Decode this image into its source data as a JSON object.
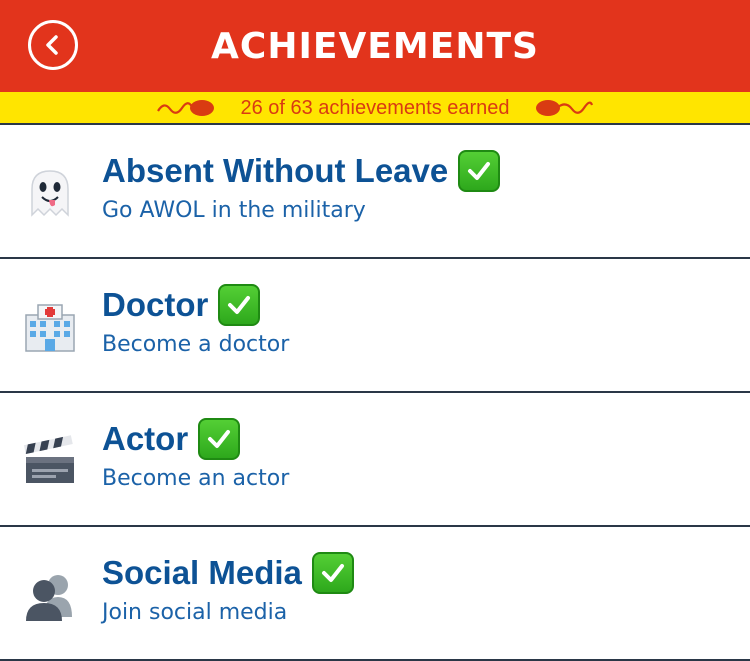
{
  "header": {
    "title": "ACHIEVEMENTS",
    "back_icon": "back-chevron-icon",
    "background_color": "#e2341c"
  },
  "banner": {
    "text": "26 of 63 achievements earned",
    "background_color": "#ffe500",
    "text_color": "#d93b12"
  },
  "achievements": [
    {
      "name": "Absent Without Leave",
      "description": "Go AWOL in the military",
      "icon": "ghost-icon",
      "earned": true
    },
    {
      "name": "Doctor",
      "description": "Become a doctor",
      "icon": "hospital-icon",
      "earned": true
    },
    {
      "name": "Actor",
      "description": "Become an actor",
      "icon": "clapperboard-icon",
      "earned": true
    },
    {
      "name": "Social Media",
      "description": "Join social media",
      "icon": "people-silhouette-icon",
      "earned": true
    }
  ],
  "colors": {
    "title_blue": "#0d5295",
    "desc_blue": "#1b62a8",
    "check_green": "#3dbb27",
    "divider": "#2a3747"
  }
}
